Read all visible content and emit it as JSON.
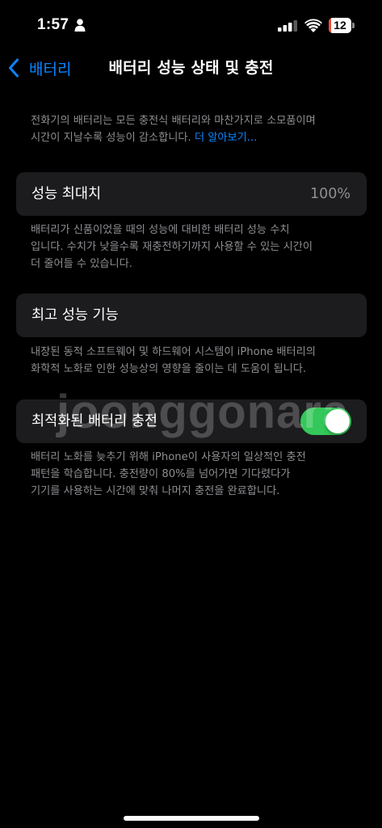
{
  "status_bar": {
    "time": "1:57",
    "battery_level": "12",
    "battery_fraction": 0.12,
    "person_icon": "person-fill-icon",
    "signal_icon": "cellular-signal-icon",
    "wifi_icon": "wifi-icon",
    "battery_icon": "battery-icon"
  },
  "nav": {
    "back_label": "배터리",
    "back_icon": "chevron-left-icon",
    "title": "배터리 성능 상태 및 충전"
  },
  "intro": {
    "text": "전화기의 배터리는 모든 충전식 배터리와 마찬가지로 소모품이며\n시간이 지날수록 성능이 감소합니다. ",
    "learn_more": "더 알아보기..."
  },
  "max_capacity": {
    "label": "성능 최대치",
    "value": "100%",
    "caption": "배터리가 신품이었을 때의 성능에 대비한 배터리 성능 수치\n입니다. 수치가 낮을수록 재충전하기까지 사용할 수 있는 시간이\n더 줄어들 수 있습니다."
  },
  "peak_performance": {
    "label": "최고 성능 기능",
    "caption": "내장된 동적 소프트웨어 및 하드웨어 시스템이 iPhone 배터리의\n화학적 노화로 인한 성능상의 영향을 줄이는 데 도움이 됩니다."
  },
  "optimized_charging": {
    "label": "최적화된 배터리 충전",
    "enabled": true,
    "caption": "배터리 노화를 늦추기 위해 iPhone이 사용자의 일상적인 충전\n패턴을 학습합니다. 충전량이 80%를 넘어가면 기다렸다가\n기기를 사용하는 시간에 맞춰 나머지 충전을 완료합니다."
  },
  "watermark": "joonggonara",
  "colors": {
    "background": "#000000",
    "cell": "#1c1c1e",
    "accent": "#0a84ff",
    "toggle_on": "#34c759",
    "secondary_text": "#8e8e93",
    "battery_low": "#eb4d3d"
  }
}
